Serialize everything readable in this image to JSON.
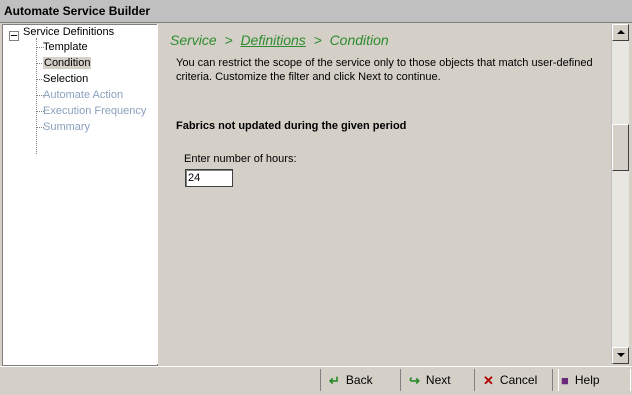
{
  "window": {
    "title": "Automate Service Builder"
  },
  "tree": {
    "root": "Service Definitions",
    "items": [
      {
        "label": "Template",
        "state": "enabled"
      },
      {
        "label": "Condition",
        "state": "selected"
      },
      {
        "label": "Selection",
        "state": "enabled"
      },
      {
        "label": "Automate Action",
        "state": "disabled"
      },
      {
        "label": "Execution Frequency",
        "state": "disabled"
      },
      {
        "label": "Summary",
        "state": "disabled"
      }
    ]
  },
  "breadcrumb": {
    "part1": "Service",
    "sep": ">",
    "part2": "Definitions",
    "part3": "Condition"
  },
  "main": {
    "description": "You can restrict the scope of the service only to those objects that match user-defined criteria. Customize the filter and click Next to continue.",
    "heading": "Fabrics not updated during the given period",
    "hours_label": "Enter number of hours:",
    "hours_value": "24"
  },
  "buttons": {
    "back": "Back",
    "next": "Next",
    "cancel": "Cancel",
    "help": "Help"
  },
  "icons": {
    "back": "back-arrow-icon",
    "next": "next-arrow-icon",
    "cancel": "cancel-x-icon",
    "help": "help-book-icon"
  },
  "colors": {
    "breadcrumb": "#2e8b2e",
    "disabled_item": "#8aa0bd",
    "background": "#d4d0c8"
  }
}
